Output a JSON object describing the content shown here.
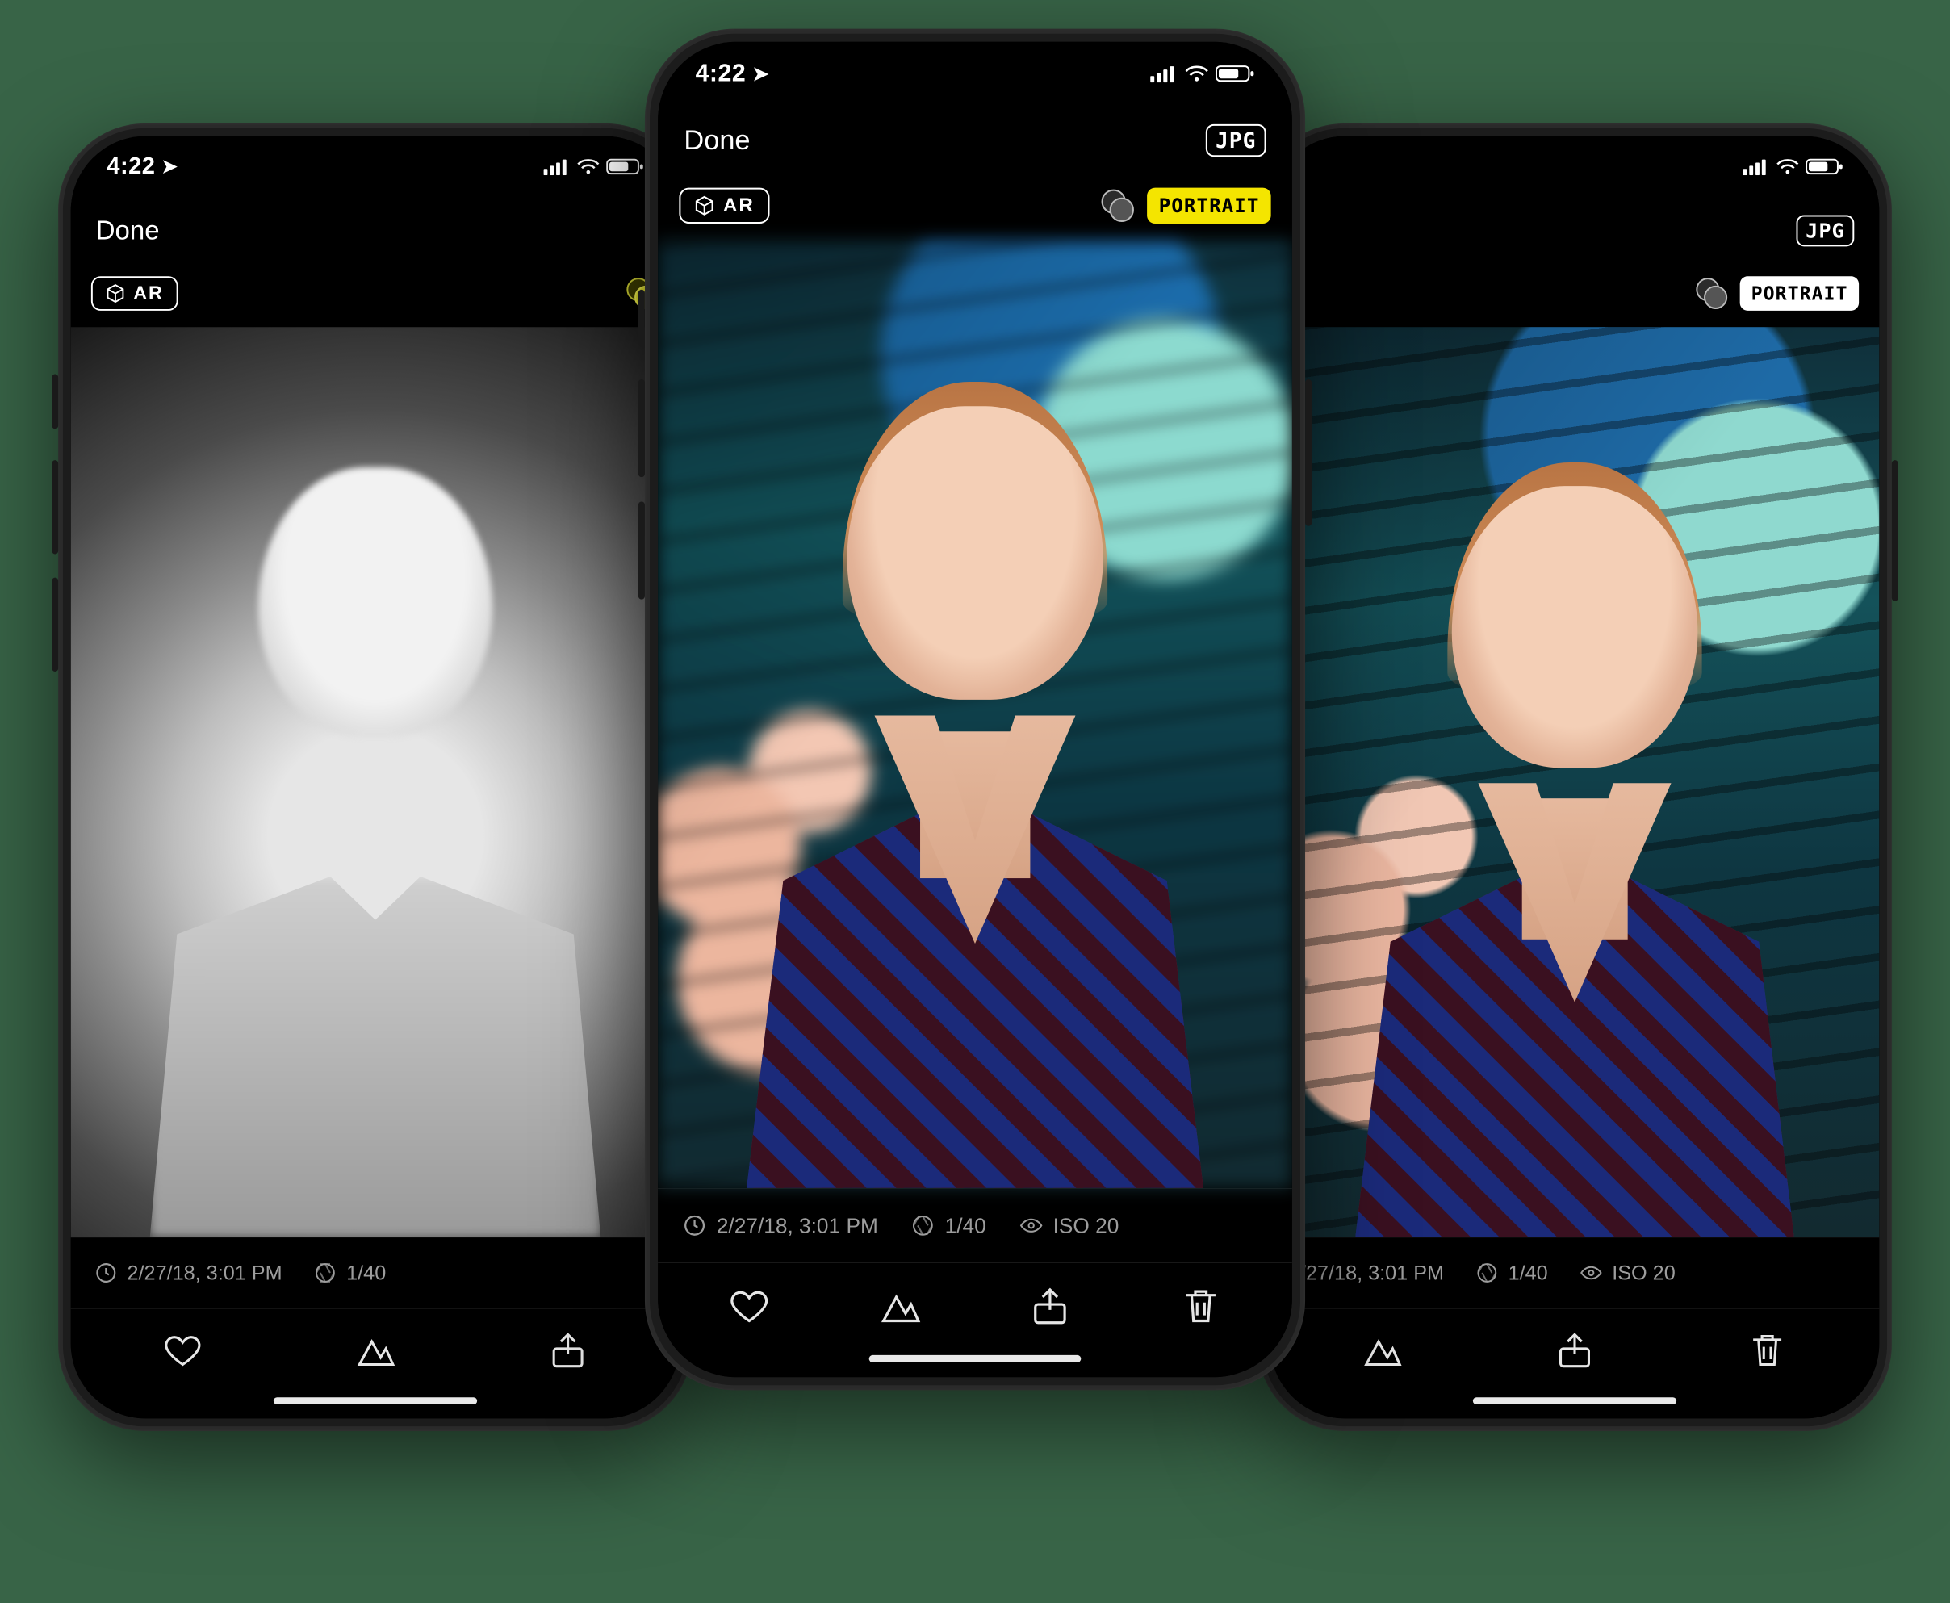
{
  "status": {
    "time": "4:22",
    "location_on": true
  },
  "nav": {
    "done": "Done",
    "format": "JPG"
  },
  "tools": {
    "ar": "AR",
    "portrait": "PORTRAIT"
  },
  "meta": {
    "timestamp": "2/27/18, 3:01 PM",
    "shutter": "1/40",
    "iso": "ISO 20"
  },
  "phones": {
    "left": {
      "ar": true,
      "depth_toggle": "active",
      "portrait": null
    },
    "mid": {
      "ar": true,
      "depth_toggle": "normal",
      "portrait": "yellow"
    },
    "right": {
      "ar": false,
      "depth_toggle": "normal",
      "portrait": "white"
    }
  }
}
